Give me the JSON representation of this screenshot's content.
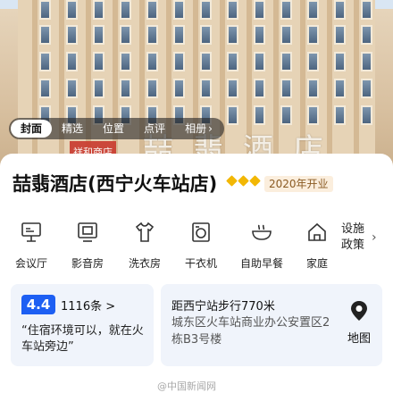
{
  "photo_tabs": [
    {
      "label": "封面",
      "active": true
    },
    {
      "label": "精选",
      "active": false
    },
    {
      "label": "位置",
      "active": false
    },
    {
      "label": "点评",
      "active": false
    },
    {
      "label": "相册",
      "active": false
    }
  ],
  "hero": {
    "sign_text": "喆翡酒店",
    "sign_red_text": "祥和商店"
  },
  "hotel": {
    "name": "喆翡酒店(西宁火车站店)",
    "diamond_rating": 3,
    "rating_color": "#f2b705",
    "open_year": "2020年开业"
  },
  "amenities": [
    {
      "label": "会议厅",
      "icon": "meeting-room-icon"
    },
    {
      "label": "影音房",
      "icon": "media-room-icon"
    },
    {
      "label": "洗衣房",
      "icon": "laundry-room-icon"
    },
    {
      "label": "干衣机",
      "icon": "dryer-icon"
    },
    {
      "label": "自助早餐",
      "icon": "breakfast-icon"
    },
    {
      "label": "家庭",
      "icon": "family-home-icon"
    }
  ],
  "policy": {
    "line1": "设施",
    "line2": "政策",
    "arrow": "›"
  },
  "review": {
    "score": "4.4",
    "count": "1116条 >",
    "quote": "“住宿环境可以，就在火车站旁边”",
    "accent_color": "#1d5ff3"
  },
  "location": {
    "walk": "距西宁站步行770米",
    "address": "城东区火车站商业办公安置区2栋B3号楼",
    "map_label": "地图"
  },
  "watermark": "@中国新闻网"
}
